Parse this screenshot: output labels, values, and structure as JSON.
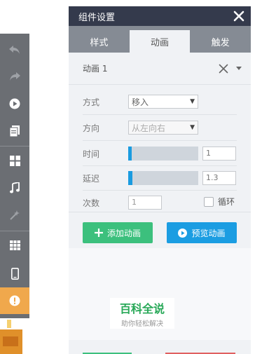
{
  "toolbar": {
    "buttons": [
      {
        "icon": "undo-icon"
      },
      {
        "icon": "redo-icon"
      },
      {
        "icon": "play-icon"
      },
      {
        "icon": "pages-icon"
      },
      {
        "icon": "grid-icon"
      },
      {
        "icon": "music-icon"
      },
      {
        "icon": "magic-wand-icon"
      },
      {
        "icon": "table-icon"
      },
      {
        "icon": "phone-icon"
      },
      {
        "icon": "alert-icon"
      }
    ],
    "colors": {
      "bg": "#6b6e73",
      "warn": "#f0a84c"
    }
  },
  "panel": {
    "title": "组件设置",
    "tabs": [
      "样式",
      "动画",
      "触发"
    ],
    "active_tab": "动画",
    "animation": {
      "name": "动画 1",
      "fields": {
        "mode_label": "方式",
        "mode_value": "移入",
        "direction_label": "方向",
        "direction_value": "从左向右",
        "time_label": "时间",
        "time_value": "1",
        "time_fill": 0.05,
        "delay_label": "延迟",
        "delay_value": "1.3",
        "delay_fill": 0.06,
        "count_label": "次数",
        "count_placeholder": "1",
        "loop_label": "循环",
        "loop_checked": false
      },
      "buttons": {
        "add_label": "添加动画",
        "preview_label": "预览动画"
      }
    },
    "colors": {
      "header": "#343a4c",
      "tabs": "#858b94",
      "add": "#3cc07d",
      "preview": "#1b9de2",
      "slider": "#1a9be0"
    }
  },
  "watermark": {
    "title": "百科全说",
    "subtitle": "助你轻松解决"
  }
}
